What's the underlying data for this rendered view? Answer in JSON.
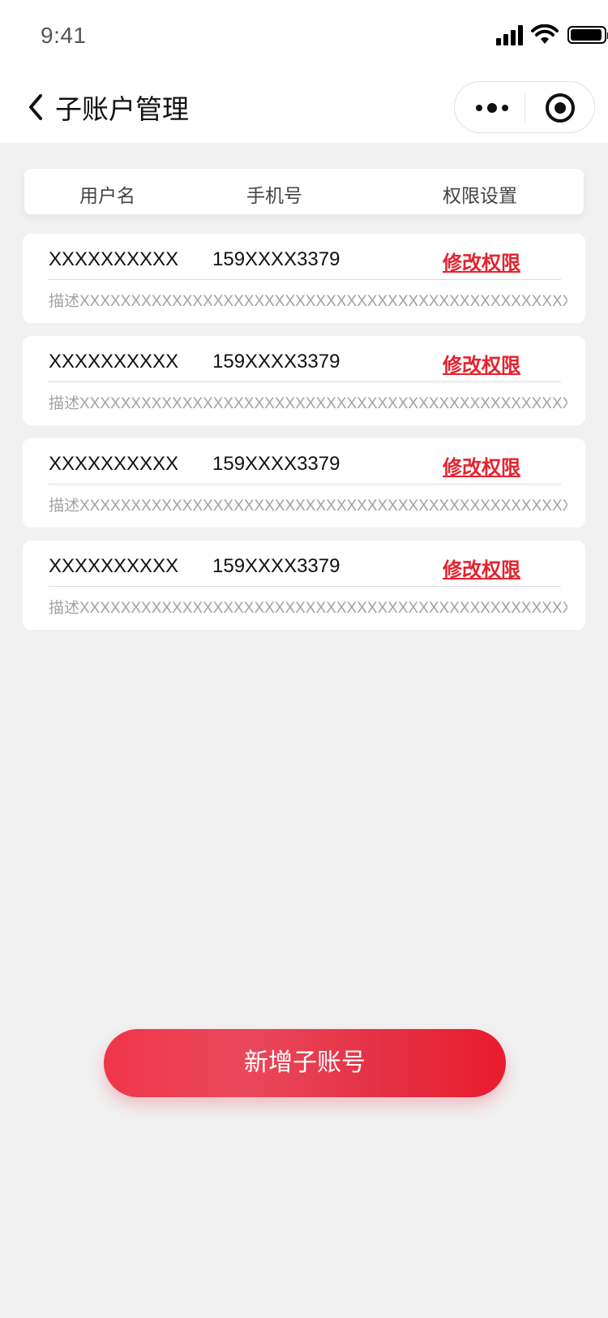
{
  "status_bar": {
    "time": "9:41"
  },
  "nav": {
    "title": "子账户管理"
  },
  "table_header": {
    "username": "用户名",
    "phone": "手机号",
    "permission": "权限设置"
  },
  "accounts": [
    {
      "username": "XXXXXXXXXX",
      "phone": "159XXXX3379",
      "action": "修改权限",
      "description": "描述XXXXXXXXXXXXXXXXXXXXXXXXXXXXXXXXXXXXXXXXXXXXXXXXXXX"
    },
    {
      "username": "XXXXXXXXXX",
      "phone": "159XXXX3379",
      "action": "修改权限",
      "description": "描述XXXXXXXXXXXXXXXXXXXXXXXXXXXXXXXXXXXXXXXXXXXXXXXXXXX"
    },
    {
      "username": "XXXXXXXXXX",
      "phone": "159XXXX3379",
      "action": "修改权限",
      "description": "描述XXXXXXXXXXXXXXXXXXXXXXXXXXXXXXXXXXXXXXXXXXXXXXXXXXX"
    },
    {
      "username": "XXXXXXXXXX",
      "phone": "159XXXX3379",
      "action": "修改权限",
      "description": "描述XXXXXXXXXXXXXXXXXXXXXXXXXXXXXXXXXXXXXXXXXXXXXXXXXXX"
    }
  ],
  "bottom": {
    "add_button_label": "新增子账号"
  },
  "colors": {
    "accent": "#e4232e",
    "background": "#f1f1f1"
  },
  "icons": [
    "signal-icon",
    "wifi-icon",
    "battery-icon",
    "back-chevron-icon",
    "more-dots-icon",
    "target-icon"
  ]
}
